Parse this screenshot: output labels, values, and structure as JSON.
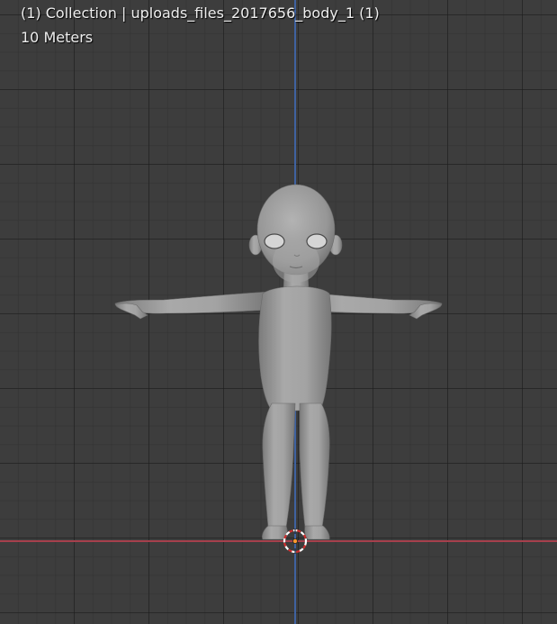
{
  "overlay": {
    "title": "(1) Collection | uploads_files_2017656_body_1 (1)",
    "scale": "10 Meters"
  },
  "colors": {
    "background": "#3d3d3d",
    "x_axis": "#a6404c",
    "y_axis": "#3f62a0",
    "mesh": "#9a9a9a",
    "origin_accent": "#ff9a2e"
  },
  "icons": [
    "3d-cursor-icon"
  ]
}
